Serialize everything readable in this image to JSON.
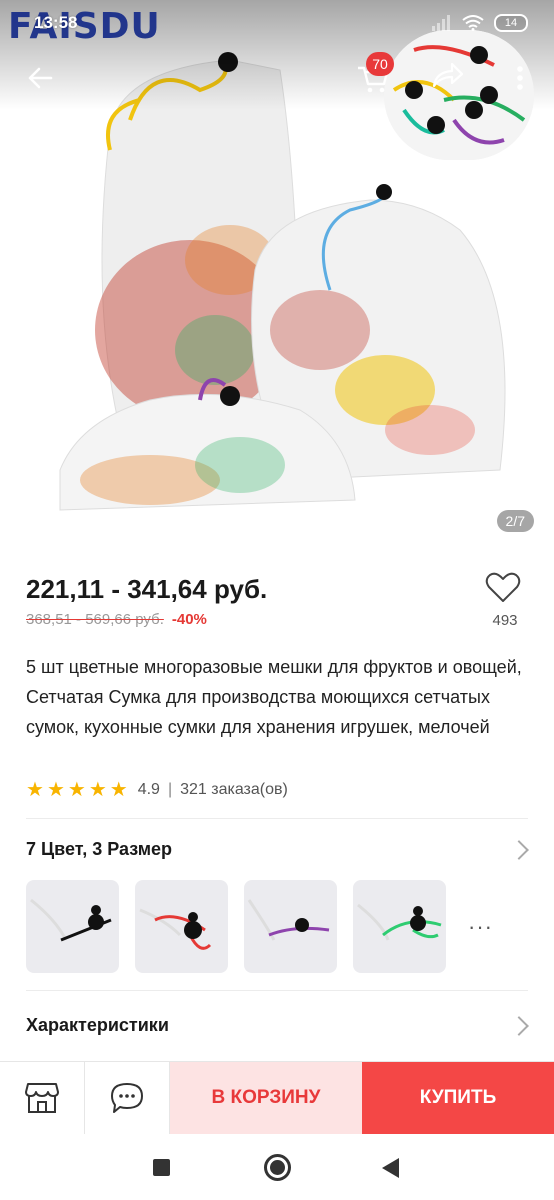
{
  "status_bar": {
    "time": "13:58",
    "battery": "14"
  },
  "watermark": "FAISDU",
  "header": {
    "cart_badge": "70"
  },
  "gallery": {
    "counter": "2/7"
  },
  "product": {
    "price": "221,11 - 341,64 руб.",
    "old_price": "368,51 - 569,66 руб.",
    "discount": "-40%",
    "favorites_count": "493",
    "title": "5 шт цветные многоразовые мешки для фруктов и овощей, Сетчатая Сумка для производства моющихся сетчатых сумок, кухонные сумки для хранения игрушек, мелочей",
    "rating": "4.9",
    "orders": "321 заказа(ов)",
    "stars": 5
  },
  "variants": {
    "title": "7 Цвет, 3 Размер",
    "swatch_colors": [
      "#111111",
      "#e53935",
      "#8e44ad",
      "#2ecc71"
    ],
    "more": "···"
  },
  "specs": {
    "title": "Характеристики"
  },
  "actions": {
    "add_to_cart": "В КОРЗИНУ",
    "buy": "КУПИТЬ",
    "store_icon": "store-icon",
    "chat_icon": "chat-icon"
  },
  "colors": {
    "accent": "#f44746",
    "accent_light": "#fde3e3",
    "star": "#f8b400"
  }
}
